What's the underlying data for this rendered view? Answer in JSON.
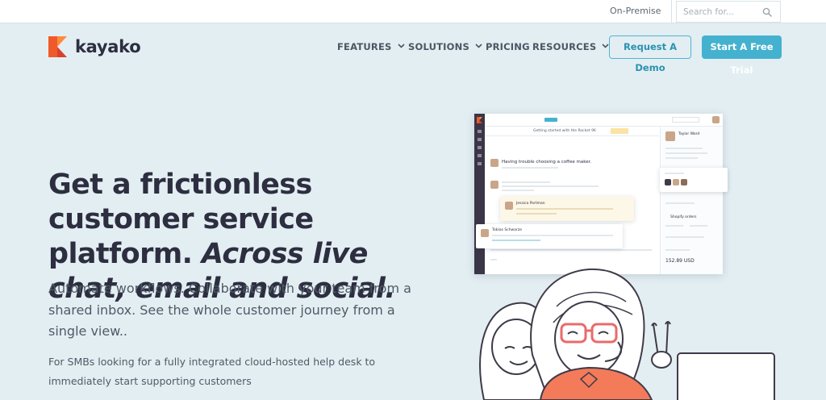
{
  "utility_bar": {
    "on_premise": "On-Premise",
    "search_placeholder": "Search for..."
  },
  "brand": {
    "name": "kayako"
  },
  "nav": {
    "items": [
      {
        "label": "FEATURES",
        "has_dropdown": true
      },
      {
        "label": "SOLUTIONS",
        "has_dropdown": true
      },
      {
        "label": "PRICING",
        "has_dropdown": false
      },
      {
        "label": "RESOURCES",
        "has_dropdown": true
      }
    ],
    "request_demo": "Request A Demo",
    "free_trial": "Start A Free Trial"
  },
  "hero": {
    "title_plain": "Get a frictionless customer service platform.",
    "title_emphasis": "Across live chat, email and social.",
    "subtitle": "Automate workflows. Collaborate with your team from a shared inbox. See the whole customer journey from a single view..",
    "note": "For SMBs looking for a fully integrated cloud-hosted help desk to immediately start supporting customers"
  },
  "product_mock": {
    "conversation_title": "Having trouble choosing a coffee maker.",
    "tab_label": "Getting started with the Rocket 96",
    "contact_name": "Taylor Ward",
    "agent_name": "Tobias Schwarze",
    "teammate_name": "Jessica Portman",
    "shopify_label": "Shopify orders",
    "amount": "152.89 USD"
  },
  "colors": {
    "background": "#e3eef3",
    "brand_accent": "#44b2cf",
    "heading": "#2d2e40",
    "logo_orange": "#f05a28",
    "illustration_orange": "#f37b5a"
  },
  "icons": {
    "search": "search-icon",
    "dropdown": "chevron-down-icon",
    "logo": "kayako-logo-icon"
  }
}
